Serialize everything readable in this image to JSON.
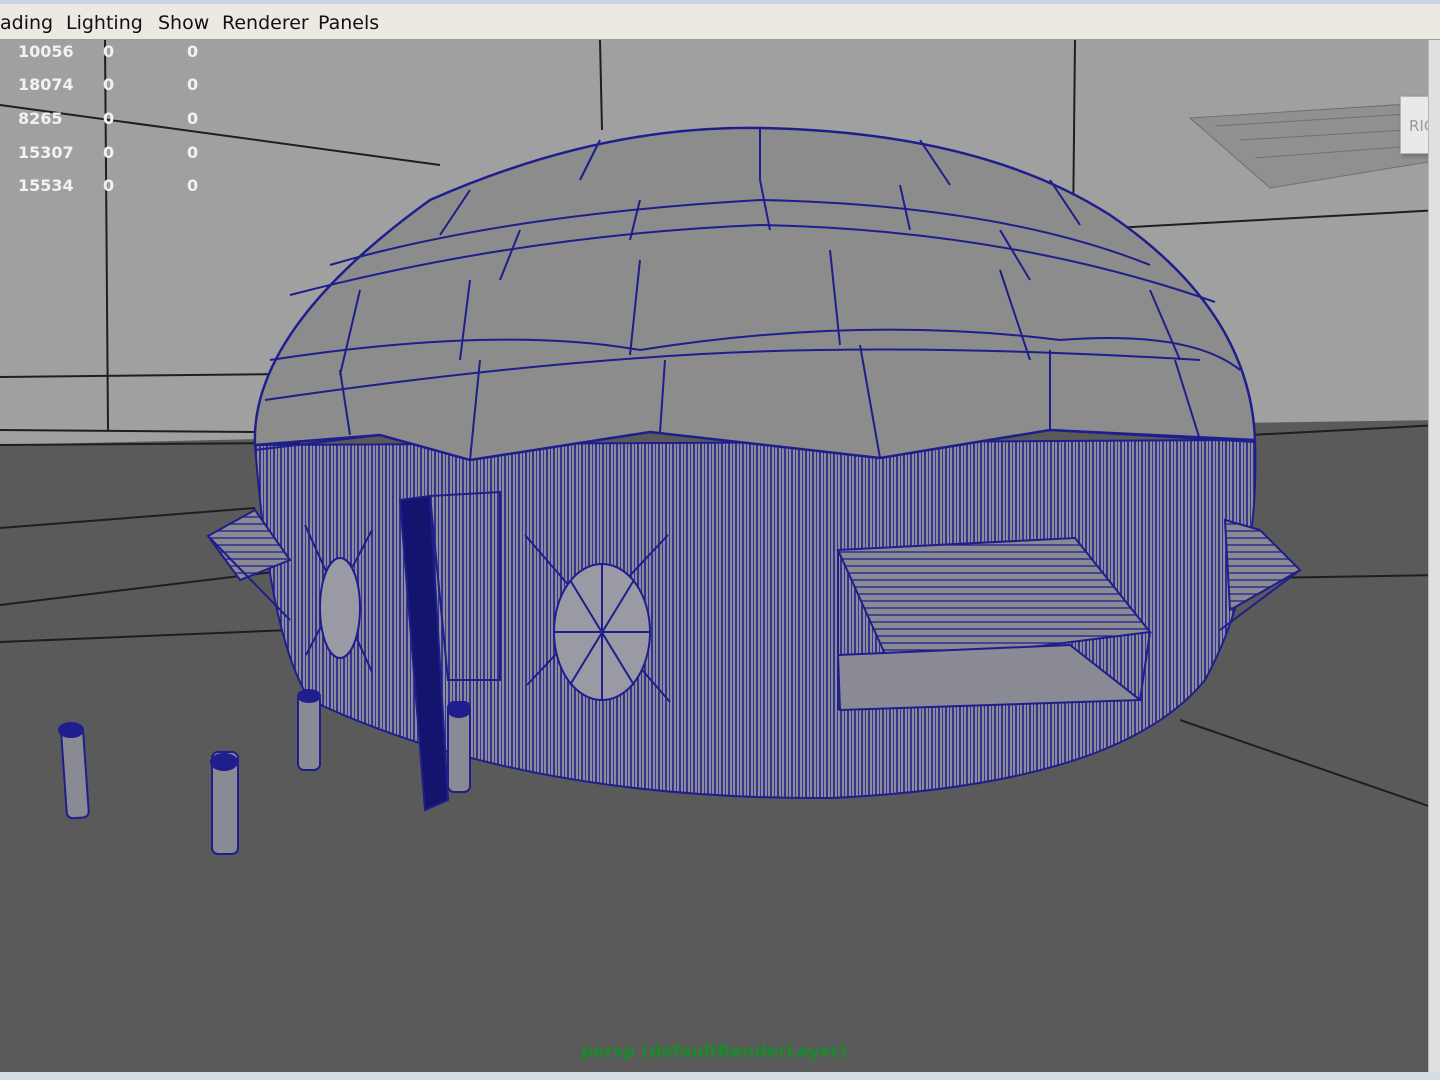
{
  "menu": [
    "ading",
    "Lighting",
    "Show",
    "Renderer",
    "Panels"
  ],
  "hud_rows": [
    [
      "10056",
      "0",
      "0"
    ],
    [
      "18074",
      "0",
      "0"
    ],
    [
      "8265",
      "0",
      "0"
    ],
    [
      "15307",
      "0",
      "0"
    ],
    [
      "15534",
      "0",
      "0"
    ]
  ],
  "camera_label": "persp (defaultRenderLayer)",
  "viewcube_label": "RIGH",
  "colors": {
    "wireframe": "#1e1e8c",
    "floor": "#5a5a5a",
    "backdrop": "#a0a0a0",
    "camera_label": "#1a8a2a",
    "hud_text": "#f2f2f2"
  }
}
